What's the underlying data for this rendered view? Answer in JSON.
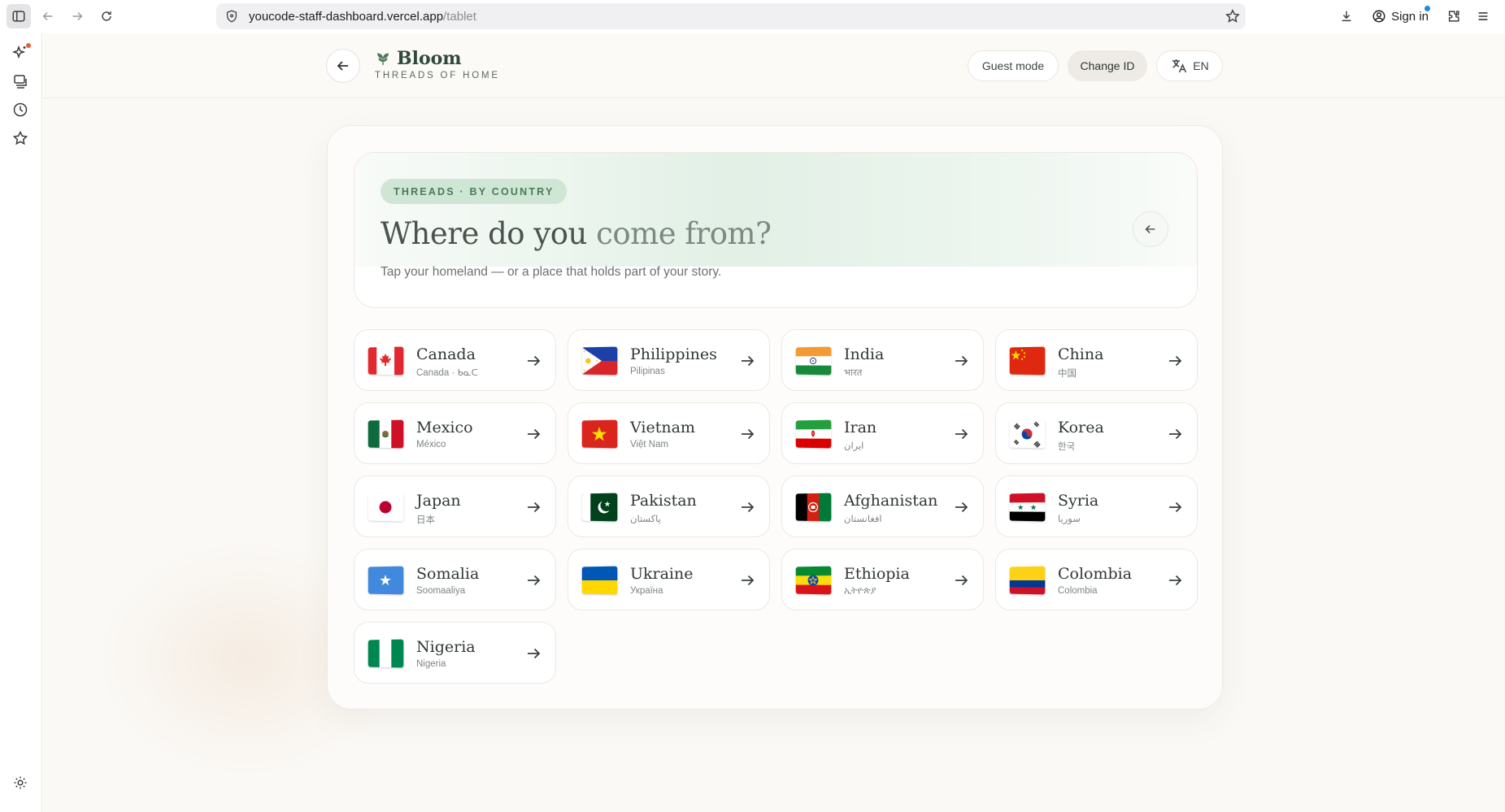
{
  "browser": {
    "url_host": "youcode-staff-dashboard.vercel.app",
    "url_path": "/tablet",
    "signin_label": "Sign in"
  },
  "header": {
    "brand_name": "Bloom",
    "brand_tagline": "THREADS OF HOME",
    "guest_label": "Guest mode",
    "change_id_label": "Change ID",
    "language_label": "EN"
  },
  "hero": {
    "badge": "THREADS · BY COUNTRY",
    "title_main": "Where do you",
    "title_muted": "come from?",
    "subtitle": "Tap your homeland — or a place that holds part of your story."
  },
  "countries": [
    {
      "name": "Canada",
      "native": "Canada · ᑲᓇᑕ",
      "flag": "canada-flag"
    },
    {
      "name": "Philippines",
      "native": "Pilipinas",
      "flag": "philippines-flag"
    },
    {
      "name": "India",
      "native": "भारत",
      "flag": "india-flag"
    },
    {
      "name": "China",
      "native": "中国",
      "flag": "china-flag"
    },
    {
      "name": "Mexico",
      "native": "México",
      "flag": "mexico-flag"
    },
    {
      "name": "Vietnam",
      "native": "Việt Nam",
      "flag": "vietnam-flag"
    },
    {
      "name": "Iran",
      "native": "ایران",
      "flag": "iran-flag"
    },
    {
      "name": "Korea",
      "native": "한국",
      "flag": "korea-flag"
    },
    {
      "name": "Japan",
      "native": "日本",
      "flag": "japan-flag"
    },
    {
      "name": "Pakistan",
      "native": "پاکستان",
      "flag": "pakistan-flag"
    },
    {
      "name": "Afghanistan",
      "native": "افغانستان",
      "flag": "afghanistan-flag"
    },
    {
      "name": "Syria",
      "native": "سوريا",
      "flag": "syria-flag"
    },
    {
      "name": "Somalia",
      "native": "Soomaaliya",
      "flag": "somalia-flag"
    },
    {
      "name": "Ukraine",
      "native": "Україна",
      "flag": "ukraine-flag"
    },
    {
      "name": "Ethiopia",
      "native": "ኢትዮጵያ",
      "flag": "ethiopia-flag"
    },
    {
      "name": "Colombia",
      "native": "Colombia",
      "flag": "colombia-flag"
    },
    {
      "name": "Nigeria",
      "native": "Nigeria",
      "flag": "nigeria-flag"
    }
  ],
  "colors": {
    "brand_green": "#2f4a3a",
    "badge_bg": "#cfe6d5",
    "page_bg": "#fbf9f6"
  }
}
